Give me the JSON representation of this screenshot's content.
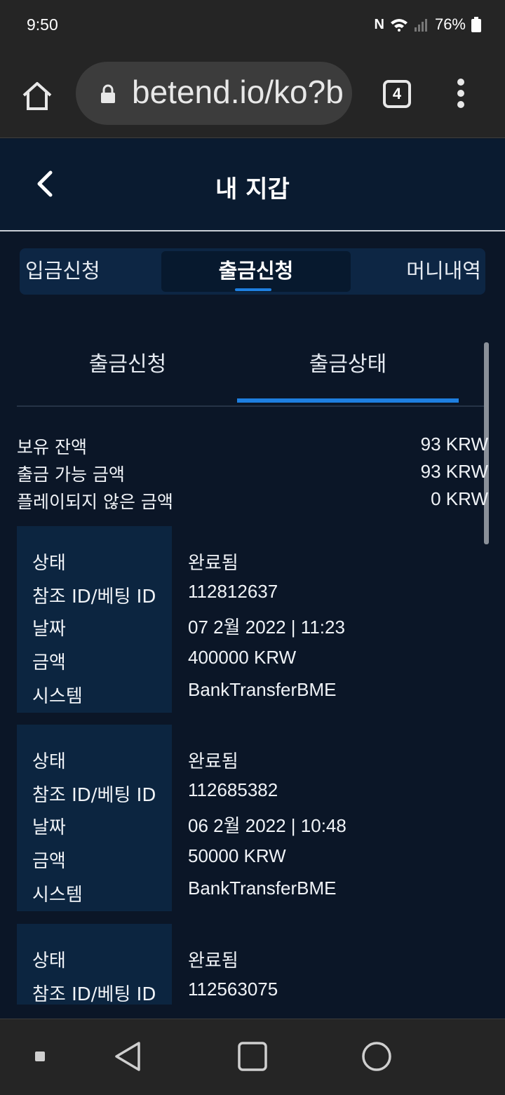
{
  "status_bar": {
    "time": "9:50",
    "battery": "76%"
  },
  "browser": {
    "url": "betend.io/ko?b",
    "tab_count": "4"
  },
  "header": {
    "title": "내 지갑"
  },
  "segment_tabs": [
    {
      "label": "입금신청"
    },
    {
      "label": "출금신청"
    },
    {
      "label": "머니내역"
    }
  ],
  "sub_tabs": [
    {
      "label": "출금신청"
    },
    {
      "label": "출금상태"
    }
  ],
  "summary": [
    {
      "label": "보유 잔액",
      "value": "93 KRW"
    },
    {
      "label": "출금 가능 금액",
      "value": "93 KRW"
    },
    {
      "label": "플레이되지 않은 금액",
      "value": "0 KRW"
    }
  ],
  "field_labels": {
    "status": "상태",
    "ref_id": "참조 ID/베팅 ID",
    "date": "날짜",
    "amount": "금액",
    "system": "시스템"
  },
  "records": [
    {
      "status": "완료됨",
      "ref_id": "112812637",
      "date": "07 2월 2022 | 11:23",
      "amount": "400000 KRW",
      "system": "BankTransferBME"
    },
    {
      "status": "완료됨",
      "ref_id": "112685382",
      "date": "06 2월 2022 | 10:48",
      "amount": "50000 KRW",
      "system": "BankTransferBME"
    },
    {
      "status": "완료됨",
      "ref_id": "112563075"
    }
  ]
}
